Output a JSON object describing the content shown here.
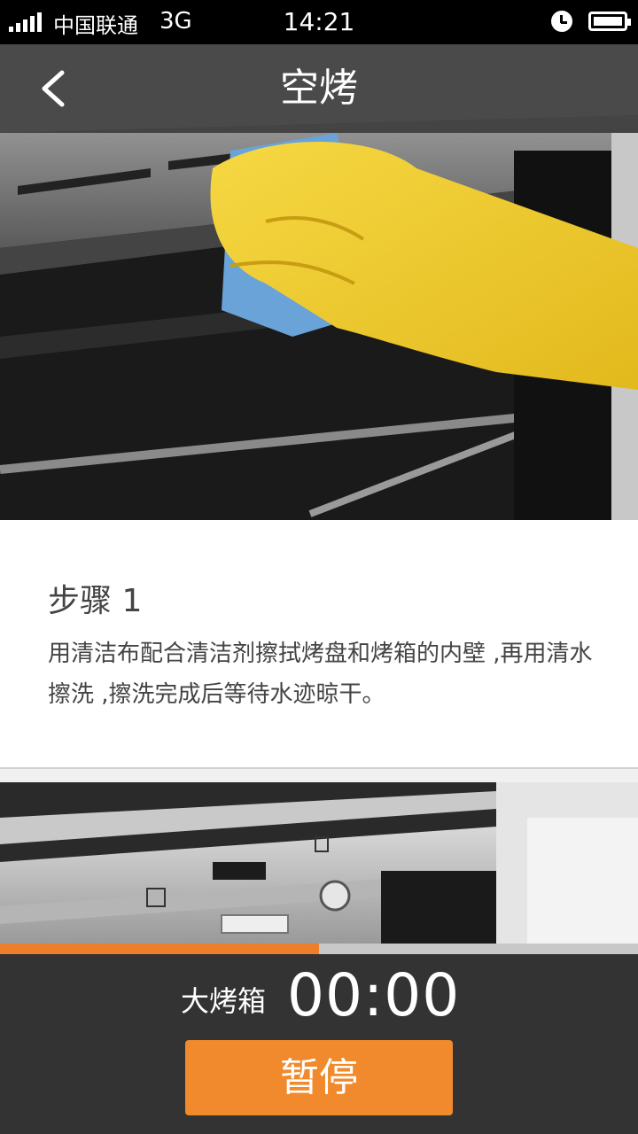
{
  "status_bar": {
    "carrier": "中国联通",
    "network": "3G",
    "time": "14:21"
  },
  "header": {
    "title": "空烤"
  },
  "step": {
    "title": "步骤 1",
    "description": "用清洁布配合清洁剂擦拭烤盘和烤箱的内壁 ,再用清水擦洗 ,擦洗完成后等待水迹晾干。"
  },
  "progress": {
    "fraction": 0.5
  },
  "control": {
    "device_label": "大烤箱",
    "timer": "00:00",
    "pause_label": "暂停"
  },
  "colors": {
    "accent": "#f08a2c",
    "progress_fill": "#ee7f2a",
    "panel_bg": "#333333"
  }
}
